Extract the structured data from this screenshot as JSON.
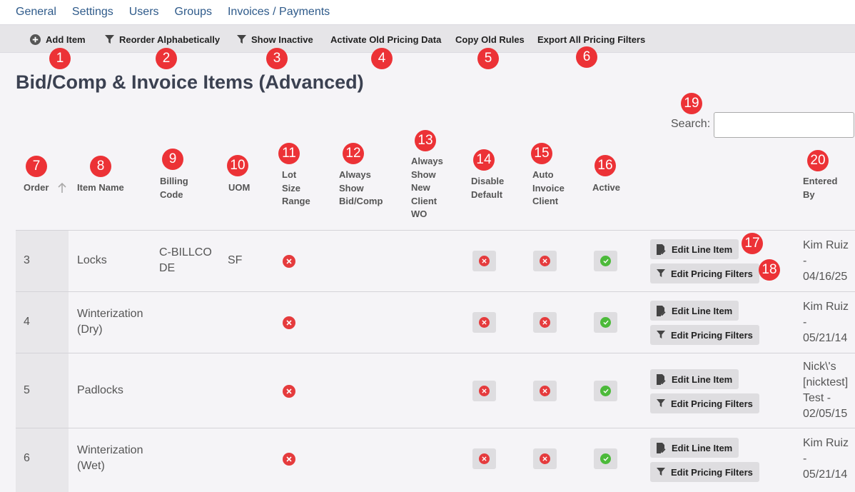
{
  "nav": [
    "General",
    "Settings",
    "Users",
    "Groups",
    "Invoices / Payments"
  ],
  "toolbar": {
    "add_item": "Add Item",
    "reorder": "Reorder Alphabetically",
    "show_inactive": "Show Inactive",
    "activate_old": "Activate Old Pricing Data",
    "copy_old_rules": "Copy Old Rules",
    "export_filters": "Export All Pricing Filters"
  },
  "page_title": "Bid/Comp & Invoice Items (Advanced)",
  "search": {
    "label": "Search:",
    "value": ""
  },
  "columns": {
    "order": "Order",
    "item_name": "Item Name",
    "billing_code": "Billing Code",
    "uom": "UOM",
    "lot_size_range": "Lot Size Range",
    "always_show_bidcomp": "Always Show Bid/Comp",
    "always_show_new_client_wo": "Always Show New Client WO",
    "disable_default": "Disable Default",
    "auto_invoice_client": "Auto Invoice Client",
    "active": "Active",
    "entered_by": "Entered By"
  },
  "buttons": {
    "edit_line_item": "Edit Line Item",
    "edit_pricing_filters": "Edit Pricing Filters"
  },
  "rows": [
    {
      "order": "3",
      "name": "Locks",
      "billing_code": "C-BILLCODE",
      "uom": "SF",
      "entered_by": "Kim Ruiz - 04/16/25"
    },
    {
      "order": "4",
      "name": "Winterization (Dry)",
      "billing_code": "",
      "uom": "",
      "entered_by": "Kim Ruiz - 05/21/14"
    },
    {
      "order": "5",
      "name": "Padlocks",
      "billing_code": "",
      "uom": "",
      "entered_by": "Nick\\'s [nicktest] Test - 02/05/15"
    },
    {
      "order": "6",
      "name": "Winterization (Wet)",
      "billing_code": "",
      "uom": "",
      "entered_by": "Kim Ruiz - 05/21/14"
    }
  ],
  "annotations": [
    "1",
    "2",
    "3",
    "4",
    "5",
    "6",
    "7",
    "8",
    "9",
    "10",
    "11",
    "12",
    "13",
    "14",
    "15",
    "16",
    "17",
    "18",
    "19",
    "20"
  ],
  "colors": {
    "badge": "#ec3236",
    "danger": "#e53b3d",
    "success": "#4cba3a",
    "link": "#2e5a8a"
  },
  "icons": {
    "add": "plus-circle-icon",
    "filter": "filter-icon",
    "edit": "edit-file-icon",
    "sort": "arrow-up-icon",
    "false": "x-circle-icon",
    "true": "check-circle-icon"
  }
}
